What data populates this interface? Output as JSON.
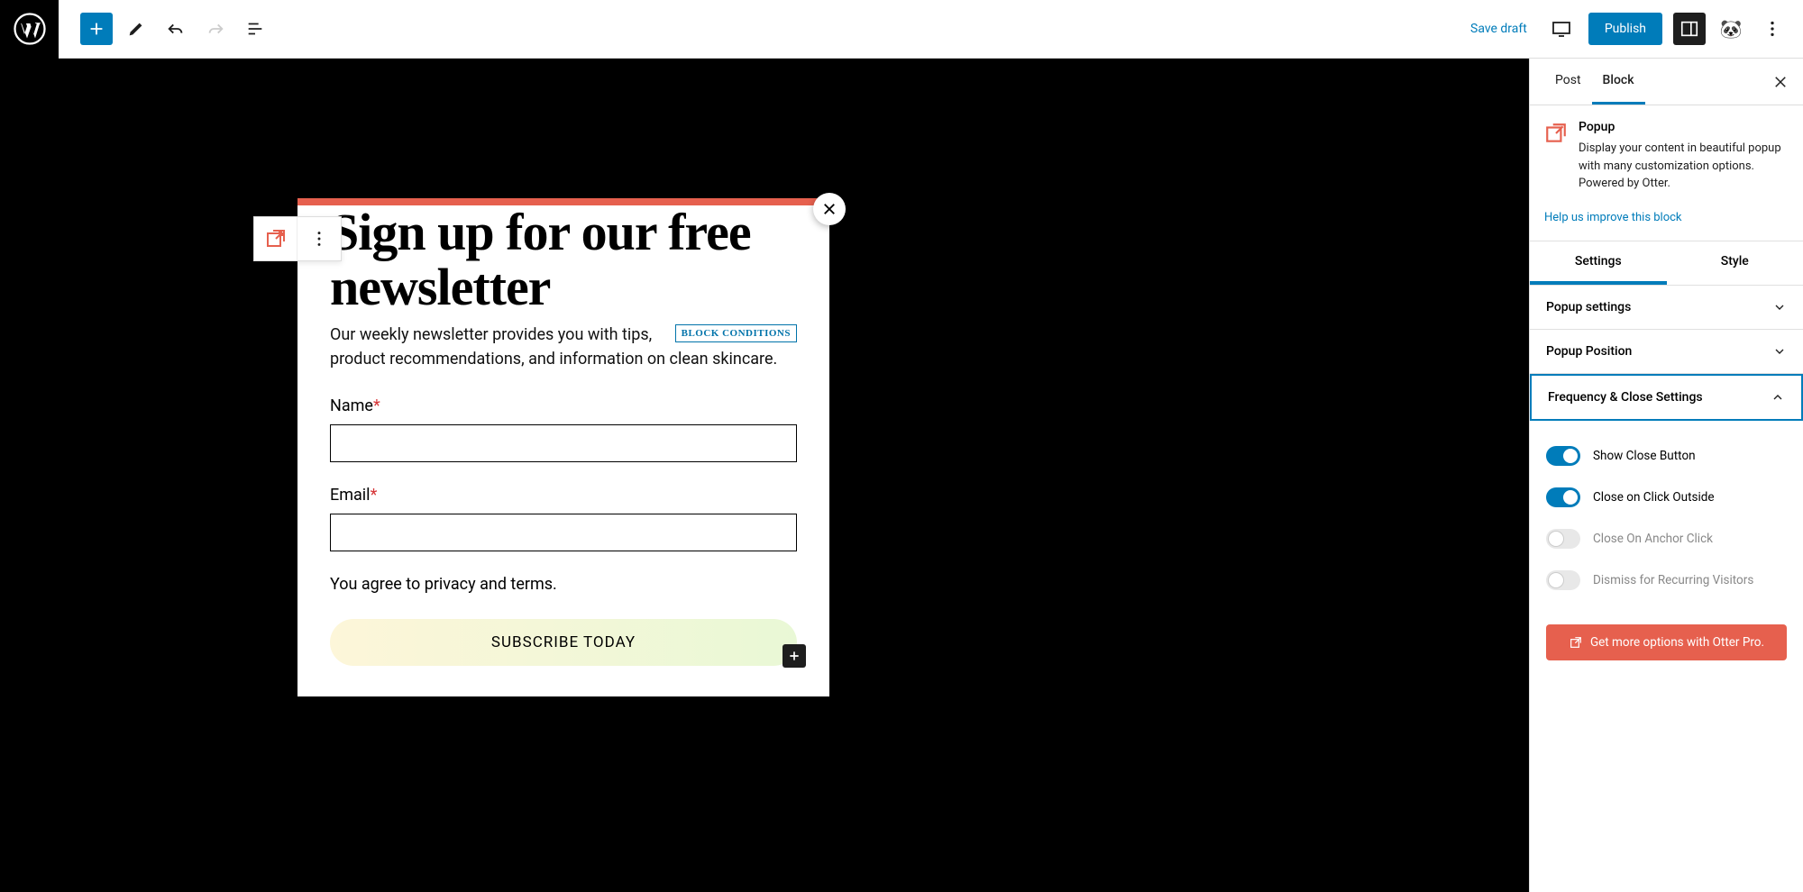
{
  "toolbar": {
    "save_draft": "Save draft",
    "publish": "Publish"
  },
  "popup": {
    "title": "Sign up for our free newsletter",
    "block_conditions": "BLOCK CONDITIONS",
    "description": "Our weekly newsletter provides you with tips, product recommendations, and information on clean skincare.",
    "name_label": "Name",
    "email_label": "Email",
    "terms": "You agree to privacy and terms.",
    "subscribe": "SUBSCRIBE TODAY"
  },
  "sidebar": {
    "tabs": {
      "post": "Post",
      "block": "Block"
    },
    "block_name": "Popup",
    "block_desc": "Display your content in beautiful popup with many customization options. Powered by Otter.",
    "help_link": "Help us improve this block",
    "settings_tabs": {
      "settings": "Settings",
      "style": "Style"
    },
    "panels": {
      "popup_settings": "Popup settings",
      "popup_position": "Popup Position",
      "frequency": "Frequency & Close Settings"
    },
    "toggles": {
      "show_close": "Show Close Button",
      "click_outside": "Close on Click Outside",
      "anchor_click": "Close On Anchor Click",
      "recurring": "Dismiss for Recurring Visitors"
    },
    "pro_cta": "Get more options with Otter Pro."
  }
}
